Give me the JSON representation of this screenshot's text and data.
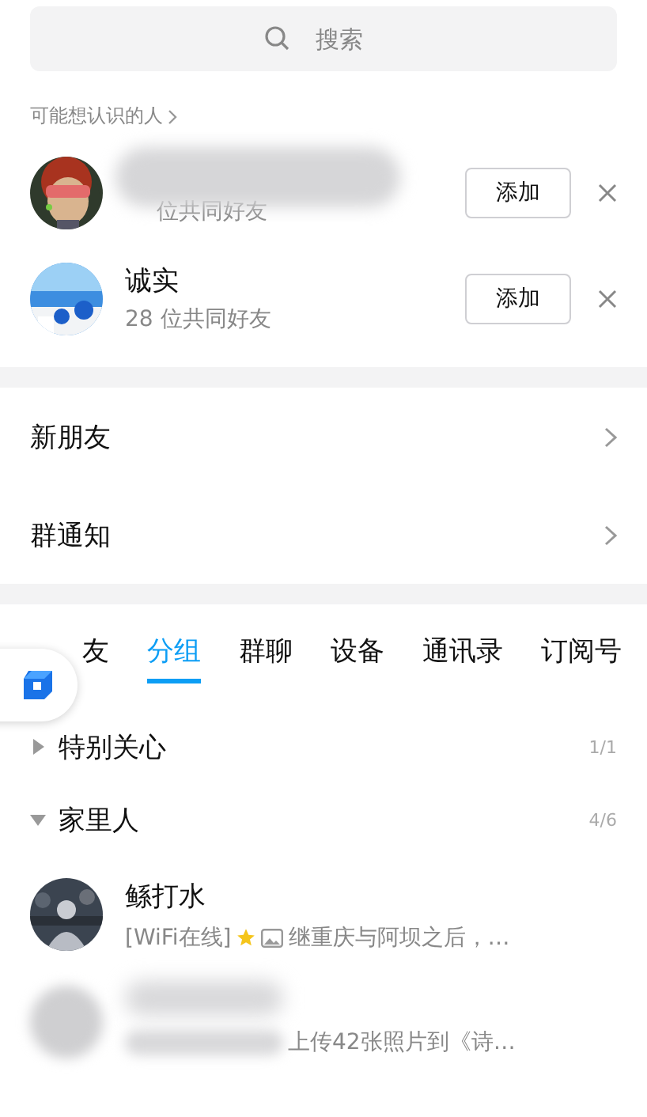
{
  "search": {
    "placeholder": "搜索"
  },
  "suggestions": {
    "title": "可能想认识的人",
    "people": [
      {
        "mutual": "位共同好友",
        "name_hidden": true,
        "button": "添加"
      },
      {
        "name": "诚实",
        "mutual": "28 位共同好友",
        "name_hidden": false,
        "button": "添加"
      }
    ]
  },
  "menu": [
    {
      "label": "新朋友"
    },
    {
      "label": "群通知"
    }
  ],
  "tabs": [
    {
      "label": "友",
      "selected": false
    },
    {
      "label": "分组",
      "selected": true
    },
    {
      "label": "群聊",
      "selected": false
    },
    {
      "label": "设备",
      "selected": false
    },
    {
      "label": "通讯录",
      "selected": false
    },
    {
      "label": "订阅号",
      "selected": false
    }
  ],
  "groups": [
    {
      "name": "特别关心",
      "count": "1/1",
      "expanded": false
    },
    {
      "name": "家里人",
      "count": "4/6",
      "expanded": true
    }
  ],
  "contacts": [
    {
      "name": "鲧打水",
      "status": "[WiFi在线]",
      "message": "继重庆与阿坝之后，…",
      "hidden": false
    },
    {
      "message": "上传42张照片到《诗…",
      "hidden": true
    }
  ]
}
